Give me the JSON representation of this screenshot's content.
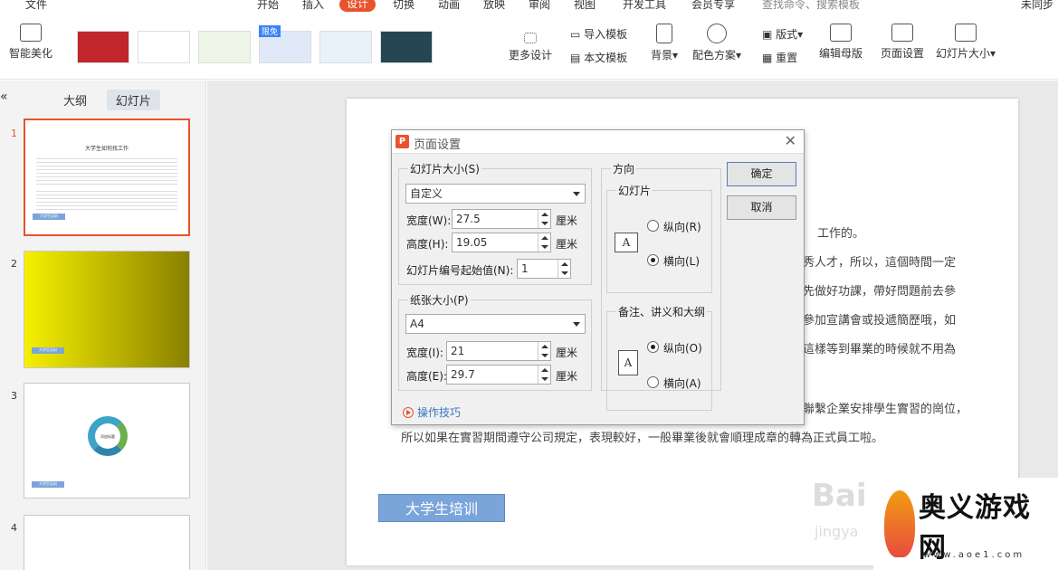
{
  "menubar": {
    "items": [
      "文件",
      "开始",
      "插入",
      "设计",
      "切换",
      "动画",
      "放映",
      "审阅",
      "视图",
      "开发工具",
      "会员专享"
    ],
    "active": "设计",
    "search_placeholder": "查找命令、搜索模板",
    "right_text": "未同步"
  },
  "toolbar": {
    "smart_beautify": "智能美化",
    "more_design": "更多设计",
    "import_template": "导入模板",
    "body_template": "本文模板",
    "background": "背景",
    "color_scheme": "配色方案",
    "layout": "版式",
    "reset": "重置",
    "edit_master": "编辑母版",
    "page_setup": "页面设置",
    "slide_size": "幻灯片大小",
    "free_badge": "限免"
  },
  "sidebar": {
    "tabs": [
      "大纲",
      "幻灯片"
    ],
    "active_tab": "幻灯片",
    "slide_numbers": [
      "1",
      "2",
      "3",
      "4"
    ],
    "thumb1_title": "大学生如何找工作",
    "thumb_button": "大学生培训",
    "thumb3_center": "添加标题"
  },
  "slide": {
    "lines": [
      "工作的。",
      "秀人才，所以，這個時間一定",
      "先做好功課，帶好問題前去參",
      "參加宣講會或投遞簡歷哦，如",
      "這樣等到畢業的時候就不用為",
      "聯繫企業安排學生實習的崗位，",
      "所以如果在實習期間遵守公司規定，表現較好，一般畢業後就會順理成章的轉為正式員工啦。"
    ],
    "button_label": "大学生培训"
  },
  "dialog": {
    "title": "页面设置",
    "slide_size_group": "幻灯片大小(S)",
    "slide_size_value": "自定义",
    "width_label": "宽度(W):",
    "width_value": "27.5",
    "height_label": "高度(H):",
    "height_value": "19.05",
    "unit": "厘米",
    "start_number_label": "幻灯片编号起始值(N):",
    "start_number_value": "1",
    "paper_group": "纸张大小(P)",
    "paper_value": "A4",
    "paper_width_label": "宽度(I):",
    "paper_width_value": "21",
    "paper_height_label": "高度(E):",
    "paper_height_value": "29.7",
    "orientation_group": "方向",
    "slides_subgroup": "幻灯片",
    "portrait_r": "纵向(R)",
    "landscape_l": "横向(L)",
    "notes_subgroup": "备注、讲义和大纲",
    "portrait_o": "纵向(O)",
    "landscape_a": "横向(A)",
    "ok": "确定",
    "cancel": "取消",
    "tips": "操作技巧",
    "paper_glyph": "A"
  },
  "watermark": {
    "site_name": "奥义游戏网",
    "site_url": "www.aoe1.com",
    "baidu_text": "Bai",
    "baidu_sub": "jingya"
  }
}
